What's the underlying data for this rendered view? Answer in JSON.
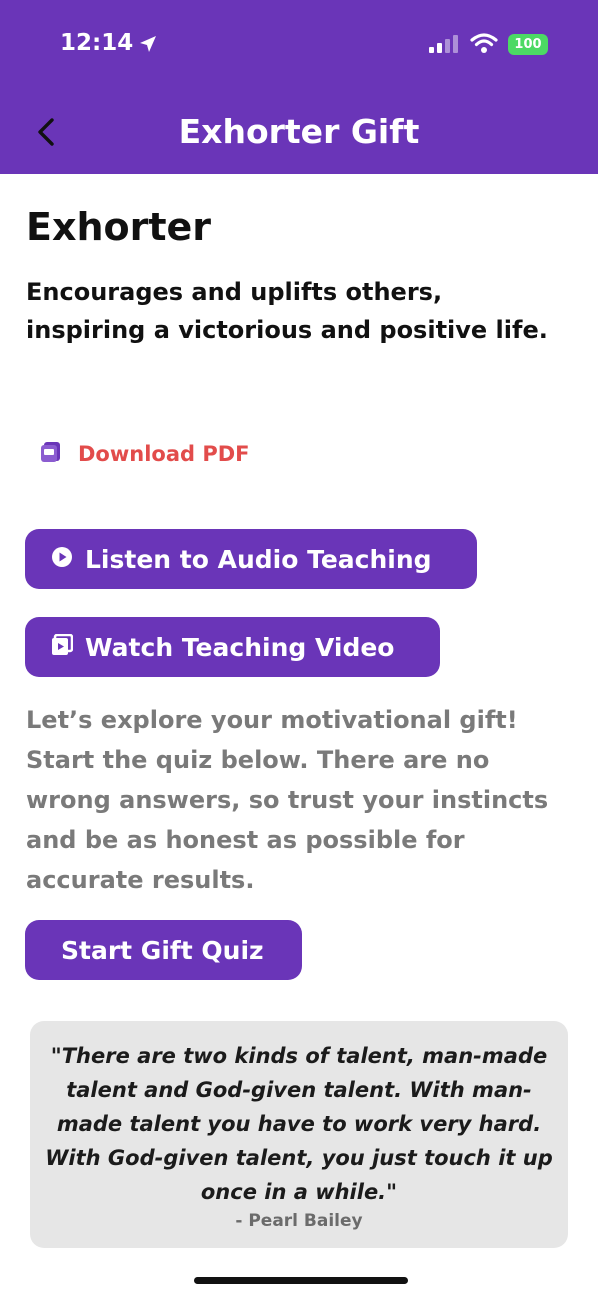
{
  "status_bar": {
    "time": "12:14",
    "battery": "100",
    "icons": [
      "location-arrow-icon",
      "cellular-signal-icon",
      "wifi-icon",
      "battery-icon"
    ]
  },
  "nav": {
    "title": "Exhorter Gift",
    "back_icon": "chevron-left-icon"
  },
  "gift": {
    "title": "Exhorter",
    "description": "Encourages and uplifts others, inspiring a victorious and positive life."
  },
  "actions": {
    "download_pdf": "Download PDF",
    "pdf_icon": "pdf-file-icon",
    "listen_audio": "Listen to Audio Teaching",
    "listen_icon": "play-circle-icon",
    "watch_video": "Watch Teaching Video",
    "watch_icon": "video-icon",
    "start_quiz": "Start Gift Quiz"
  },
  "intro_text": "Let’s explore your motivational gift! Start the quiz below. There are no wrong answers, so trust your instincts and be as honest as possible for accurate results.",
  "quote": {
    "text": "\"There are two kinds of talent, man-made talent and God-given talent. With man-made talent you have to work very hard. With God-given talent, you just touch it up once in a while.\"",
    "author": "- Pearl Bailey"
  },
  "colors": {
    "brand_purple": "#6a35b8",
    "pdf_red": "#e24c4b",
    "body_gray": "#7a7a7a",
    "quote_bg": "#e6e6e6"
  }
}
